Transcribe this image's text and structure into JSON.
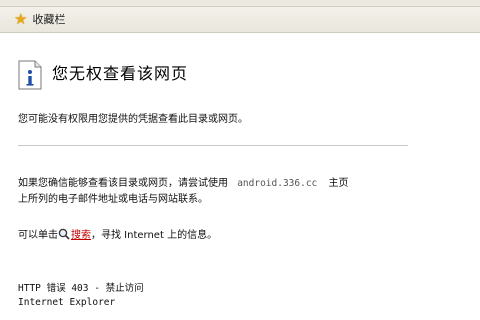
{
  "favorites_bar": {
    "label": "收藏栏",
    "icon": "star-icon"
  },
  "page": {
    "title": "您无权查看该网页",
    "line1": "您可能没有权限用您提供的凭据查看此目录或网页。",
    "para2_part1": "如果您确信能够查看该目录或网页，请尝试使用",
    "url": "android.336.cc",
    "para2_part2": "主页",
    "para2_line2": "上所列的电子邮件地址或电话与网站联系。",
    "search_prefix": "可以单击",
    "search_link": "搜索",
    "search_suffix": "，寻找 Internet 上的信息。",
    "error_code": "HTTP 错误 403 - 禁止访问",
    "browser": "Internet Explorer"
  },
  "colors": {
    "link": "#c00000",
    "info_icon_blue": "#1f4fa8"
  }
}
